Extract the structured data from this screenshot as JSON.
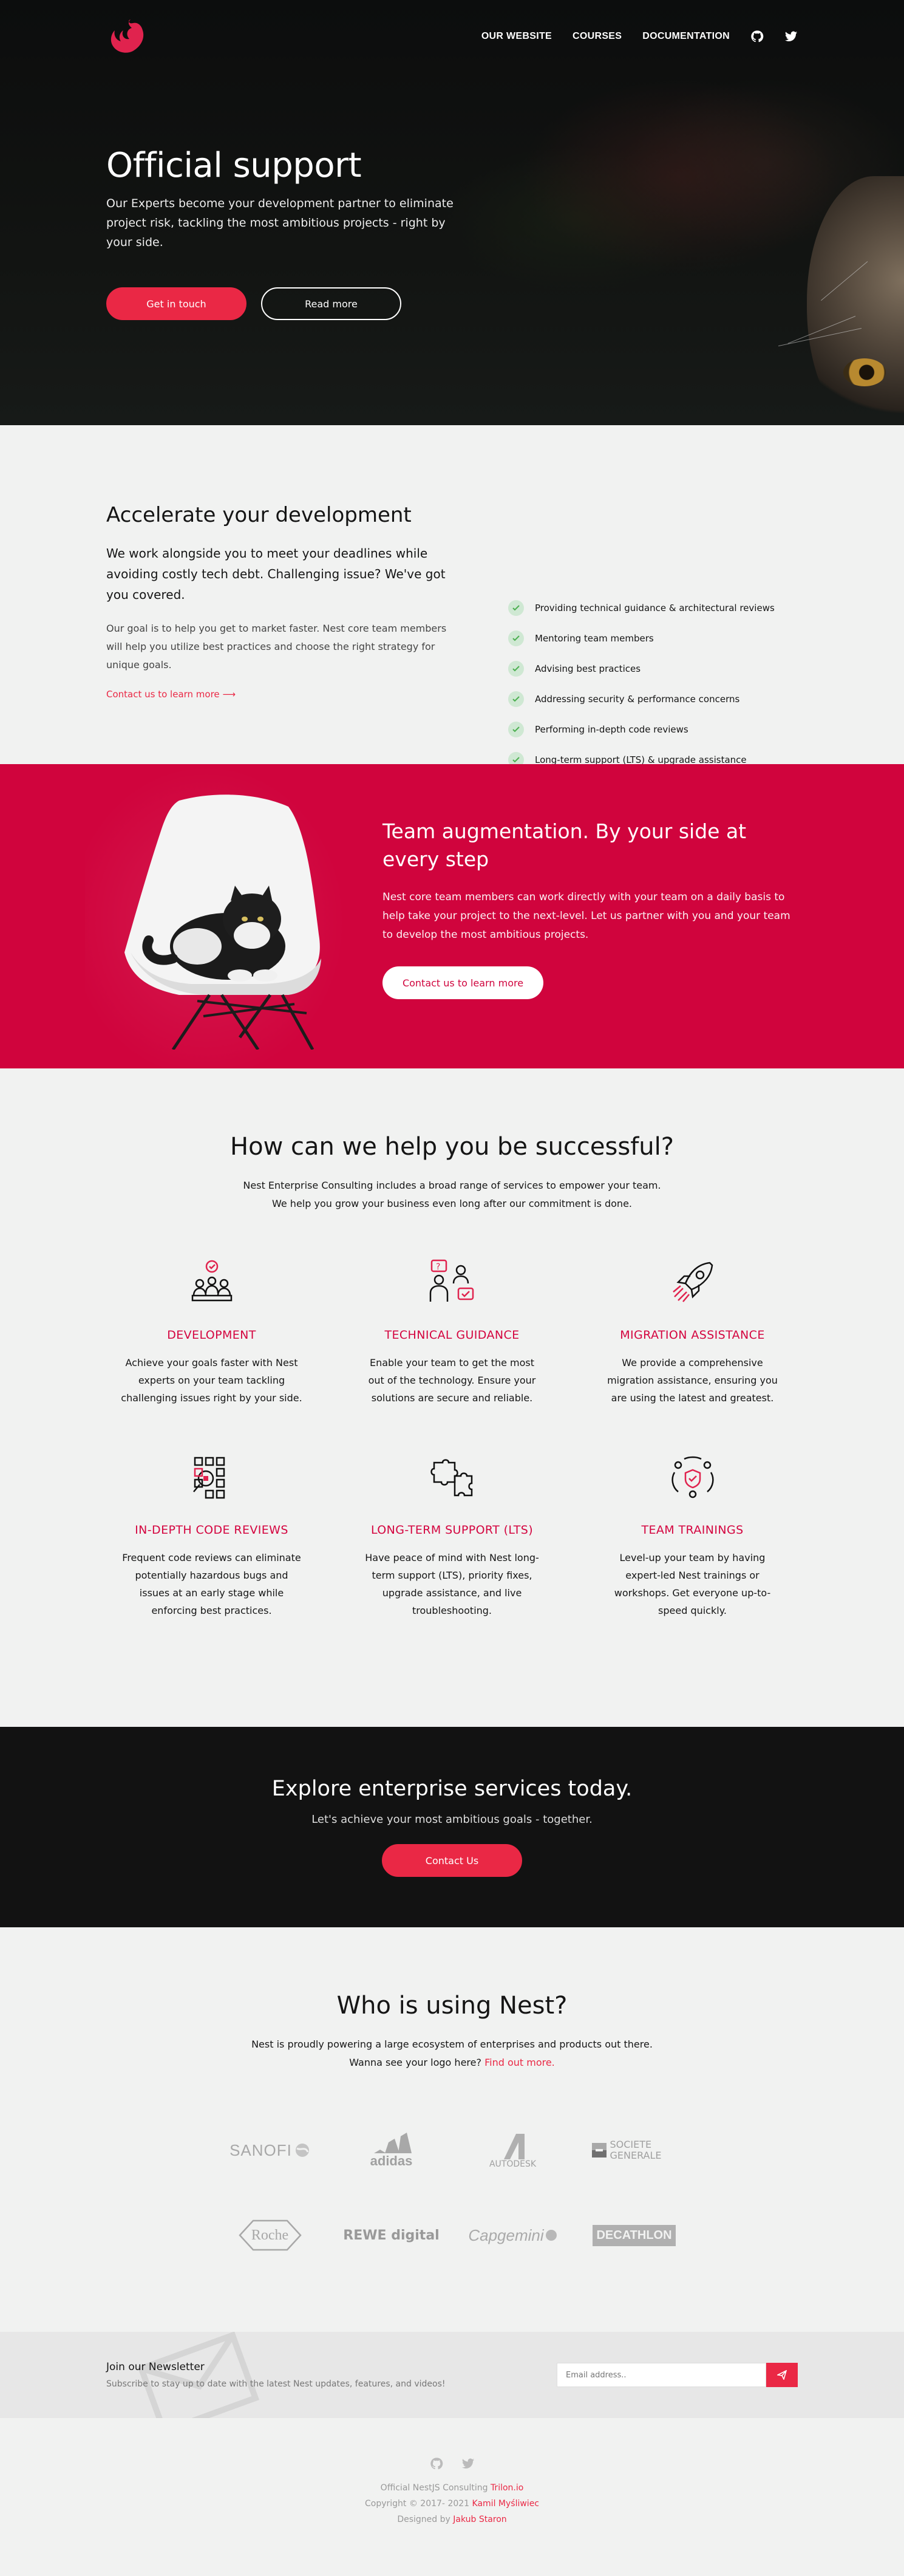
{
  "nav": {
    "links": [
      "OUR WEBSITE",
      "COURSES",
      "DOCUMENTATION"
    ],
    "icons": [
      "github-icon",
      "twitter-icon"
    ]
  },
  "hero": {
    "title": "Official support",
    "text": "Our Experts become your development partner to eliminate project risk, tackling the most ambitious projects - right by your side.",
    "primary_button": "Get in touch",
    "secondary_button": "Read more"
  },
  "accelerate": {
    "title": "Accelerate your development",
    "lead": "We work alongside you to meet your deadlines while avoiding costly tech debt. Challenging issue? We've got you covered.",
    "body": "Our goal is to help you get to market faster. Nest core team members will help you utilize best practices and choose the right strategy for unique goals.",
    "link": "Contact us to learn more",
    "checklist": [
      "Providing technical guidance & architectural reviews",
      "Mentoring team members",
      "Advising best practices",
      "Addressing security & performance concerns",
      "Performing in-depth code reviews",
      "Long-term support (LTS) & upgrade assistance"
    ]
  },
  "team": {
    "title": "Team augmentation. By your side at every step",
    "text": "Nest core team members can work directly with your team on a daily basis to help take your project to the next-level. Let us partner with you and your team to develop the most ambitious projects.",
    "button": "Contact us to learn more"
  },
  "help": {
    "title": "How can we help you be successful?",
    "subtitle_line1": "Nest Enterprise Consulting includes a broad range of services to empower your team.",
    "subtitle_line2": "We help you grow your business even long after our commitment is done.",
    "services": [
      {
        "title": "DEVELOPMENT",
        "text": "Achieve your goals faster with Nest experts on your team tackling challenging issues right by your side.",
        "icon": "team-icon"
      },
      {
        "title": "TECHNICAL GUIDANCE",
        "text": "Enable your team to get the most out of the technology. Ensure your solutions are secure and reliable.",
        "icon": "mentoring-icon"
      },
      {
        "title": "MIGRATION ASSISTANCE",
        "text": "We provide a comprehensive migration assistance, ensuring you are using the latest and greatest.",
        "icon": "rocket-icon"
      },
      {
        "title": "IN-DEPTH CODE REVIEWS",
        "text": "Frequent code reviews can eliminate potentially hazardous bugs and issues at an early stage while enforcing best practices.",
        "icon": "code-review-icon"
      },
      {
        "title": "LONG-TERM SUPPORT (LTS)",
        "text": "Have peace of mind with Nest long-term support (LTS), priority fixes, upgrade assistance, and live troubleshooting.",
        "icon": "puzzle-icon"
      },
      {
        "title": "TEAM TRAININGS",
        "text": "Level-up your team by having expert-led Nest trainings or workshops. Get everyone up-to-speed quickly.",
        "icon": "training-icon"
      }
    ]
  },
  "explore": {
    "title": "Explore enterprise services today.",
    "subtitle": "Let's achieve your most ambitious goals - together.",
    "button": "Contact Us"
  },
  "users": {
    "title": "Who is using Nest?",
    "line1": "Nest is proudly powering a large ecosystem of enterprises and products out there.",
    "line2_text": "Wanna see your logo here?",
    "line2_link": "Find out more.",
    "logos": [
      "SANOFI",
      "adidas",
      "AUTODESK",
      "SOCIETE GENERALE",
      "Roche",
      "REWE digital",
      "Capgemini",
      "DECATHLON"
    ]
  },
  "newsletter": {
    "title": "Join our Newsletter",
    "subtitle": "Subscribe to stay up to date with the latest Nest updates, features, and videos!",
    "placeholder": "Email address.."
  },
  "footer": {
    "line1_text": "Official NestJS Consulting",
    "line1_link": "Trilon.io",
    "line2_text": "Copyright © 2017- 2021",
    "line2_link": "Kamil Myśliwiec",
    "line3_text": "Designed by",
    "line3_link": "Jakub Staron"
  },
  "colors": {
    "accent": "#ea2845",
    "team_bg": "#d0043d",
    "dark": "#121212",
    "light_bg": "#f1f2f1"
  }
}
